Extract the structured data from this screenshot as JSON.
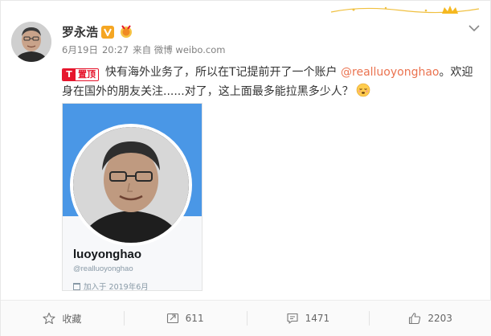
{
  "post": {
    "author": "罗永浩",
    "verified_icon": "verified-v-icon",
    "medal_icon": "fan-medal-icon",
    "meta": {
      "date": "6月19日",
      "time": "20:27",
      "source": "来自 微博 weibo.com"
    },
    "pinned_label": "置顶",
    "text_before_mention": "快有海外业务了，所以在T记提前开了一个账户 ",
    "mention": "@realluoyonghao",
    "text_after_mention": "。欢迎身在国外的朋友关注......对了，这上面最多能拉黑多少人？",
    "emoji": "sleepy-face-emoji"
  },
  "media": {
    "display_name": "luoyonghao",
    "handle": "@realluoyonghao",
    "joined": "加入于 2019年6月",
    "banner_color": "#4a97e6"
  },
  "actions": {
    "favorite_label": "收藏",
    "repost_count": "611",
    "comment_count": "1471",
    "like_count": "2203"
  },
  "colors": {
    "accent_orange": "#eb7350",
    "pin_red": "#e6162d",
    "verified_orange": "#f5a623"
  }
}
